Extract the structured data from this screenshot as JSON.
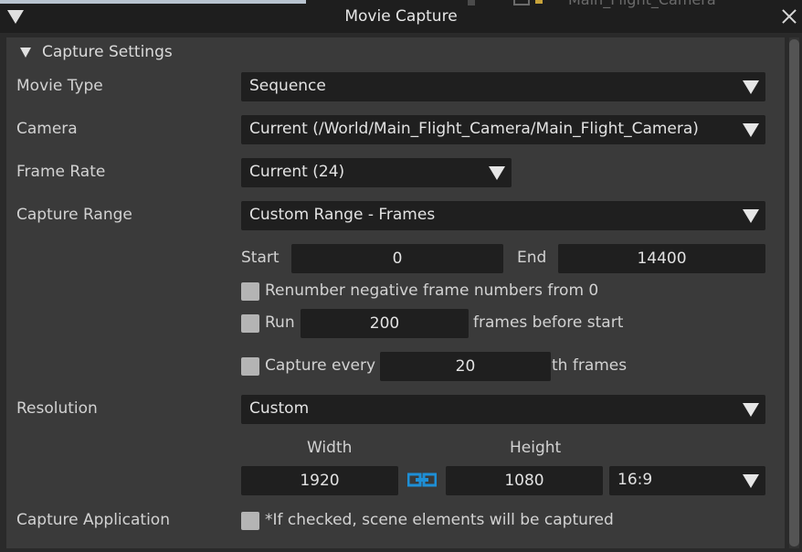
{
  "window": {
    "title": "Movie Capture",
    "background_text": "Main_Flight_Camera"
  },
  "section": {
    "title": "Capture Settings"
  },
  "movie_type": {
    "label": "Movie Type",
    "value": "Sequence"
  },
  "camera": {
    "label": "Camera",
    "value": "Current (/World/Main_Flight_Camera/Main_Flight_Camera)"
  },
  "frame_rate": {
    "label": "Frame Rate",
    "value": "Current (24)"
  },
  "capture_range": {
    "label": "Capture Range",
    "value": "Custom Range - Frames",
    "start_label": "Start",
    "start_value": "0",
    "end_label": "End",
    "end_value": "14400"
  },
  "renumber": {
    "label": "Renumber negative frame numbers from 0",
    "checked": false
  },
  "run": {
    "label": "Run",
    "value": "200",
    "suffix": "frames before start",
    "checked": false
  },
  "capture_every": {
    "label": "Capture every",
    "value": "20",
    "suffix": "th frames",
    "checked": false
  },
  "resolution": {
    "label": "Resolution",
    "value": "Custom",
    "width_label": "Width",
    "height_label": "Height",
    "width_value": "1920",
    "height_value": "1080",
    "aspect": "16:9",
    "link_icon": "chain-link-icon"
  },
  "capture_application": {
    "label": "Capture Application",
    "note": "*If checked, scene elements will be captured",
    "checked": false
  },
  "colors": {
    "accent": "#1e8fd6",
    "field_bg": "#1f1f1f",
    "panel_bg": "#3a3a3a"
  }
}
